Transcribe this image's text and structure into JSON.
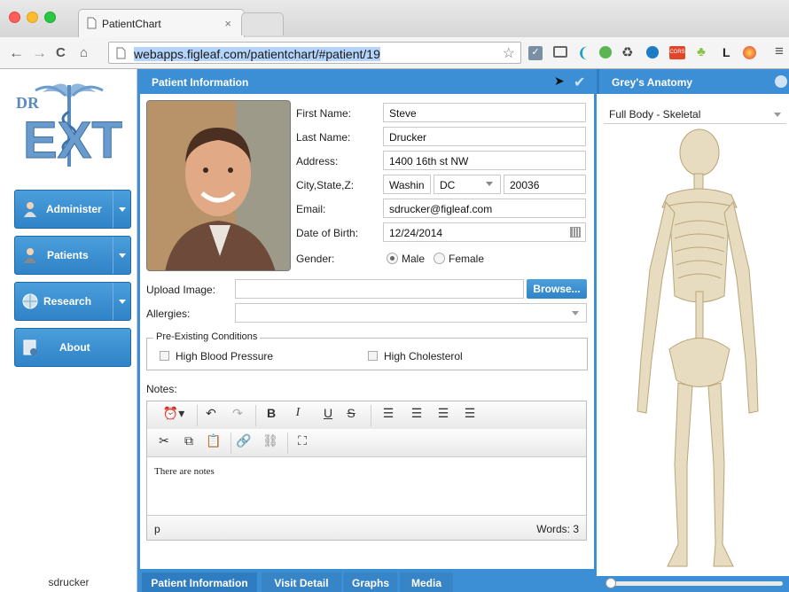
{
  "browser": {
    "tab_title": "PatientChart",
    "tab_close": "×",
    "url_host": "webapps.figleaf.com",
    "url_path": "/patientchart/#patient/19",
    "ext_letter": "L"
  },
  "sidebar": {
    "logo_text_top": "DR",
    "logo_text_main": "EXT",
    "items": [
      {
        "label": "Administer",
        "icon": "admin-person-icon",
        "has_menu": true
      },
      {
        "label": "Patients",
        "icon": "patient-person-icon",
        "has_menu": true
      },
      {
        "label": "Research",
        "icon": "globe-icon",
        "has_menu": true
      },
      {
        "label": "About",
        "icon": "info-document-icon",
        "has_menu": false
      }
    ],
    "user": "sdrucker"
  },
  "patient_panel": {
    "title": "Patient Information",
    "labels": {
      "first_name": "First Name:",
      "last_name": "Last Name:",
      "address": "Address:",
      "city_state_zip": "City,State,Z:",
      "email": "Email:",
      "dob": "Date of Birth:",
      "gender": "Gender:",
      "upload": "Upload Image:",
      "allergies": "Allergies:",
      "conditions": "Pre-Existing Conditions",
      "notes": "Notes:"
    },
    "values": {
      "first_name": "Steve",
      "last_name": "Drucker",
      "address": "1400 16th st NW",
      "city": "Washin",
      "state": "DC",
      "zip": "20036",
      "email": "sdrucker@figleaf.com",
      "dob": "12/24/2014",
      "gender": "Male"
    },
    "gender_options": [
      "Male",
      "Female"
    ],
    "browse_label": "Browse...",
    "conditions": [
      {
        "label": "High Blood Pressure",
        "checked": false
      },
      {
        "label": "High Cholesterol",
        "checked": false
      }
    ],
    "editor": {
      "body": "There are notes",
      "path": "p",
      "word_count": "Words: 3"
    }
  },
  "bottom_tabs": [
    "Patient Information",
    "Visit Detail",
    "Graphs",
    "Media"
  ],
  "anatomy": {
    "title": "Grey's Anatomy",
    "selection": "Full Body - Skeletal"
  },
  "colors": {
    "accent": "#3c8fd4",
    "button": "#2f83c7"
  }
}
